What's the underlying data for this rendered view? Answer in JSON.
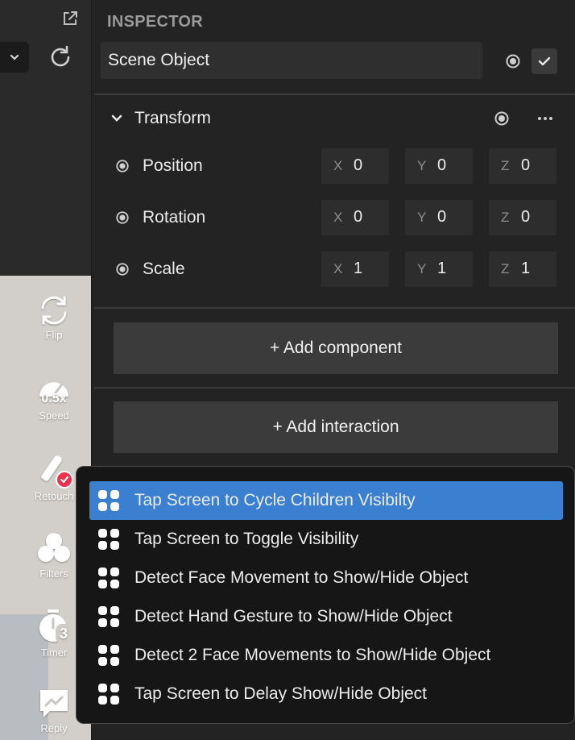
{
  "inspector": {
    "title": "INSPECTOR",
    "object_name": "Scene Object"
  },
  "transform": {
    "label": "Transform",
    "properties": [
      {
        "label": "Position",
        "x": "0",
        "y": "0",
        "z": "0"
      },
      {
        "label": "Rotation",
        "x": "0",
        "y": "0",
        "z": "0"
      },
      {
        "label": "Scale",
        "x": "1",
        "y": "1",
        "z": "1"
      }
    ],
    "axis_labels": {
      "x": "X",
      "y": "Y",
      "z": "Z"
    }
  },
  "buttons": {
    "add_component": "+ Add component",
    "add_interaction": "+ Add interaction"
  },
  "side_tools": [
    {
      "label": "Flip",
      "icon": "flip-icon"
    },
    {
      "label": "Speed",
      "icon": "speed-icon",
      "badge": "0.5x"
    },
    {
      "label": "Retouch",
      "icon": "retouch-icon"
    },
    {
      "label": "Filters",
      "icon": "filters-icon"
    },
    {
      "label": "Timer",
      "icon": "timer-icon",
      "badge": "3"
    },
    {
      "label": "Reply",
      "icon": "reply-icon"
    }
  ],
  "interaction_menu": {
    "selected_index": 0,
    "items": [
      "Tap Screen to Cycle Children Visibilty",
      "Tap Screen to Toggle Visibility",
      "Detect Face Movement to Show/Hide Object",
      "Detect Hand Gesture to Show/Hide Object",
      "Detect 2 Face Movements to Show/Hide Object",
      "Tap Screen to Delay Show/Hide Object"
    ]
  },
  "colors": {
    "panel_bg": "#232323",
    "field_bg": "#2d2d2d",
    "accent_blue": "#3a7fd0",
    "retouch_badge": "#f0324f"
  }
}
